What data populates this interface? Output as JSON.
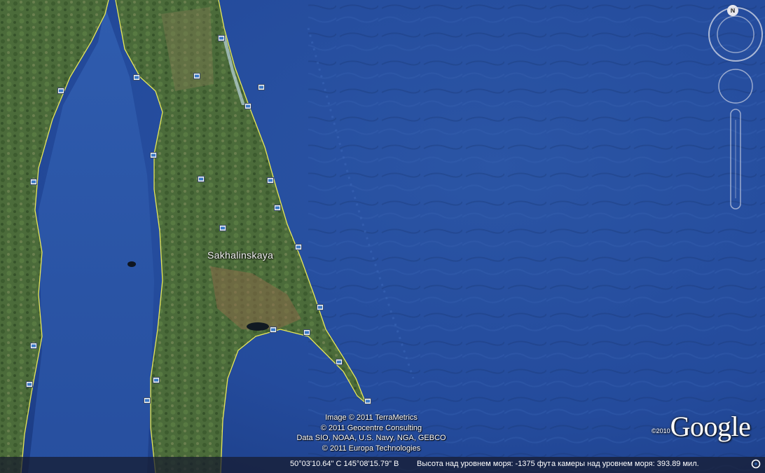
{
  "map": {
    "region_label": "Sakhalinskaya",
    "attribution": [
      "Image © 2011 TerraMetrics",
      "© 2011 Geocentre Consulting",
      "Data SIO, NOAA, U.S. Navy, NGA, GEBCO",
      "© 2011 Europa Technologies"
    ],
    "logo": {
      "year": "©2010",
      "brand": "Google"
    },
    "compass_label": "N",
    "colors": {
      "ocean": "#23489a",
      "ocean_deep": "#1b3a80",
      "land": "#4d6f3a",
      "border": "#e6e65a"
    },
    "placemark_icon": "photo-placemark-icon"
  },
  "statusbar": {
    "coordinates": "50°03'10.64\" С  145°08'15.79\" В",
    "altitude": "Высота над уровнем моря: -1375 фут",
    "eye_altitude": "а камеры над уровнем моря:   393.89 мил."
  }
}
